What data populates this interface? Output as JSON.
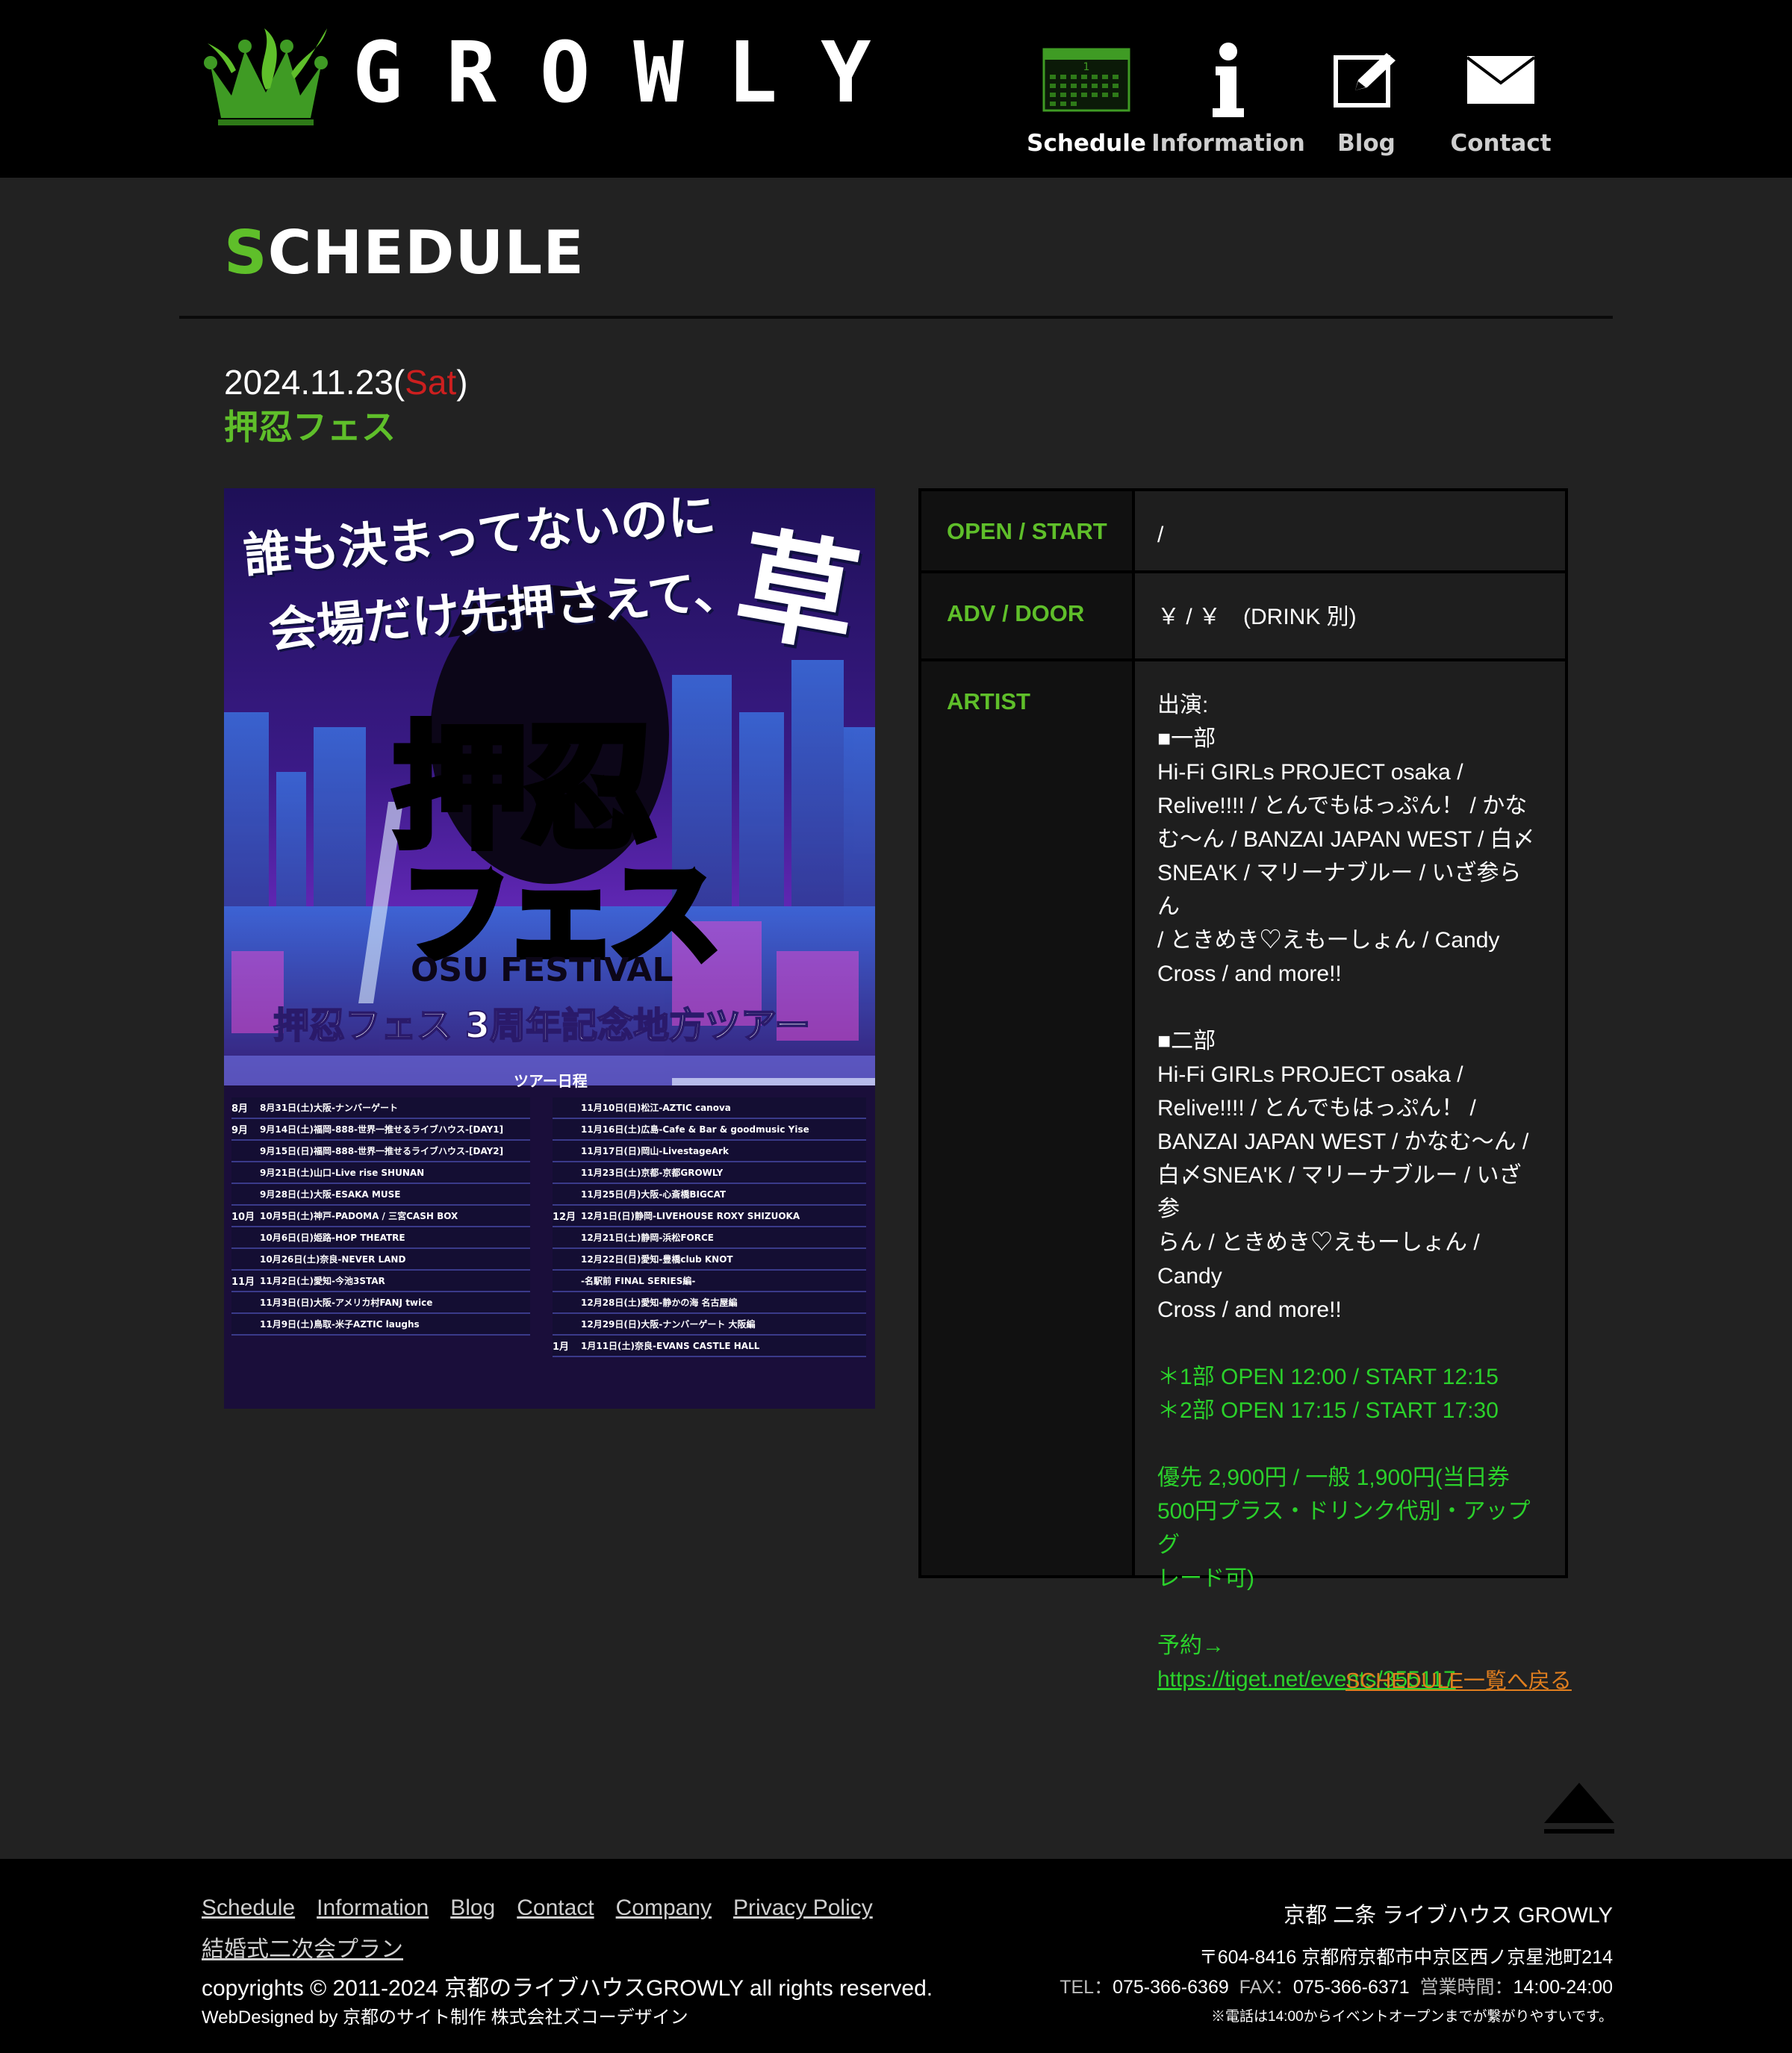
{
  "header": {
    "logo_text": "GROWLY",
    "nav": [
      {
        "label": "Schedule",
        "icon": "calendar-icon"
      },
      {
        "label": "Information",
        "icon": "info-icon"
      },
      {
        "label": "Blog",
        "icon": "edit-icon"
      },
      {
        "label": "Contact",
        "icon": "envelope-icon"
      }
    ]
  },
  "section": {
    "title_first": "S",
    "title_rest": "CHEDULE"
  },
  "event": {
    "date": "2024.11.23",
    "open_paren": "(",
    "dow": "Sat",
    "close_paren": ")",
    "title": "押忍フェス",
    "flyer": {
      "headline1": "誰も決まってないのに",
      "headline2": "会場だけ先押さえて、",
      "kusa": "草",
      "logo1": "押忍",
      "logo2": "フェス",
      "logo_en": "OSU FESTIVAL",
      "subtitle": "押忍フェス 3周年記念地方ツアー",
      "tour_label": "ツアー日程",
      "left": [
        {
          "m": "8月",
          "d": "8月31日(土)大阪-ナンバーゲート"
        },
        {
          "m": "9月",
          "d": "9月14日(土)福岡-888-世界一推せるライブハウス-[DAY1]"
        },
        {
          "m": "",
          "d": "9月15日(日)福岡-888-世界一推せるライブハウス-[DAY2]"
        },
        {
          "m": "",
          "d": "9月21日(土)山口-Live rise SHUNAN"
        },
        {
          "m": "",
          "d": "9月28日(土)大阪-ESAKA MUSE"
        },
        {
          "m": "10月",
          "d": "10月5日(土)神戸-PADOMA / 三宮CASH BOX"
        },
        {
          "m": "",
          "d": "10月6日(日)姫路-HOP THEATRE"
        },
        {
          "m": "",
          "d": "10月26日(土)奈良-NEVER LAND"
        },
        {
          "m": "11月",
          "d": "11月2日(土)愛知-今池3STAR"
        },
        {
          "m": "",
          "d": "11月3日(日)大阪-アメリカ村FANJ twice"
        },
        {
          "m": "",
          "d": "11月9日(土)鳥取-米子AZTIC laughs"
        }
      ],
      "right": [
        {
          "m": "",
          "d": "11月10日(日)松江-AZTIC canova"
        },
        {
          "m": "",
          "d": "11月16日(土)広島-Cafe & Bar & goodmusic Yise"
        },
        {
          "m": "",
          "d": "11月17日(日)岡山-LivestageArk"
        },
        {
          "m": "",
          "d": "11月23日(土)京都-京都GROWLY"
        },
        {
          "m": "",
          "d": "11月25日(月)大阪-心斎橋BIGCAT"
        },
        {
          "m": "12月",
          "d": "12月1日(日)静岡-LIVEHOUSE ROXY SHIZUOKA"
        },
        {
          "m": "",
          "d": "12月21日(土)静岡-浜松FORCE"
        },
        {
          "m": "",
          "d": "12月22日(日)愛知-豊橋club KNOT"
        },
        {
          "m": "",
          "d": "-名駅前 FINAL SERIES編-"
        },
        {
          "m": "",
          "d": "12月28日(土)愛知-静かの海 名古屋編"
        },
        {
          "m": "",
          "d": "12月29日(日)大阪-ナンバーゲート 大阪編"
        },
        {
          "m": "1月",
          "d": "1月11日(土)奈良-EVANS CASTLE HALL"
        }
      ]
    }
  },
  "info": {
    "open_label": "OPEN / START",
    "open_value": "/",
    "adv_label": "ADV / DOOR",
    "adv_value": "￥ / ￥　(DRINK 別)",
    "artist_label": "ARTIST",
    "artist_lines": [
      "出演:",
      "■一部",
      "Hi-Fi GIRLs PROJECT osaka /",
      "Relive!!!! / とんでもはっぷん！ / かな",
      "む〜ん / BANZAI JAPAN WEST / 白〆",
      "SNEA'K / マリーナブルー / いざ参らん",
      "/ ときめき♡えもーしょん / Candy",
      "Cross / and more!!",
      "",
      "■二部",
      "Hi-Fi GIRLs PROJECT osaka /",
      "Relive!!!! / とんでもはっぷん！ /",
      "BANZAI JAPAN WEST / かなむ〜ん /",
      "白〆SNEA'K / マリーナブルー / いざ参",
      "らん / ときめき♡えもーしょん / Candy",
      "Cross / and more!!",
      ""
    ],
    "green_lines": [
      "＊1部 OPEN 12:00 / START 12:15",
      "＊2部 OPEN 17:15 / START 17:30",
      "",
      "優先 2,900円 / 一般 1,900円(当日券",
      "500円プラス・ドリンク代別・アップグ",
      "レード可)",
      "",
      "予約→"
    ],
    "ticket_url": "https://tiget.net/events/355117"
  },
  "back_link": "SCHEDULE一覧へ戻る",
  "footer": {
    "links": [
      "Schedule",
      "Information",
      "Blog",
      "Contact",
      "Company",
      "Privacy Policy",
      "結婚式二次会プラン"
    ],
    "copyright": "copyrights © 2011-2024 京都のライブハウスGROWLY all rights reserved.",
    "webdesigned": "WebDesigned by 京都のサイト制作 株式会社ズコーデザイン",
    "venue_name": "京都 二条 ライブハウス GROWLY",
    "address": "〒604-8416 京都府京都市中京区西ノ京星池町214",
    "tel_label": "TEL：",
    "tel": "075-366-6369",
    "fax_label": "FAX：",
    "fax": "075-366-6371",
    "hours_label": "営業時間：",
    "hours": "14:00-24:00",
    "note": "※電話は14:00からイベントオープンまでが繋がりやすいです。"
  },
  "colors": {
    "accent_green": "#5fbf2a",
    "text_green": "#2bd12b",
    "link_orange": "#e07e1e",
    "sat_red": "#cc1f1f",
    "background": "#222222"
  }
}
